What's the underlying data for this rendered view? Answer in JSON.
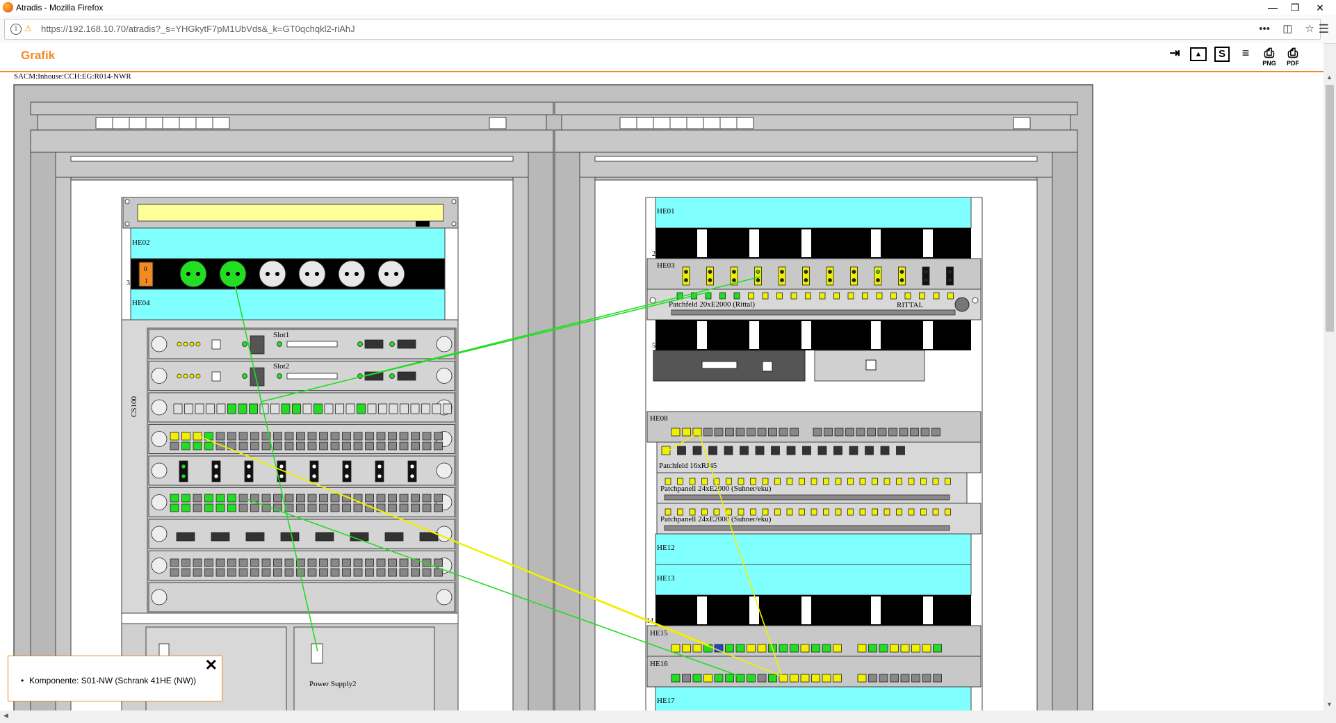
{
  "window": {
    "title": "Atradis - Mozilla Firefox",
    "minimize": "—",
    "restore": "❐",
    "close": "✕"
  },
  "browser": {
    "url": "https://192.168.10.70/atradis?_s=YHGkytF7pM1UbVds&_k=GT0qchqkl2-riAhJ",
    "more": "•••",
    "pocket": "◫",
    "bookmark": "☆",
    "menu": "☰"
  },
  "page": {
    "heading": "Grafik",
    "path": "SACM:Inhouse:CCH:EG:R014-NWR",
    "toolbar": [
      {
        "name": "export-icon",
        "glyph": "⇥",
        "label": ""
      },
      {
        "name": "image-icon",
        "glyph": "▲",
        "label": ""
      },
      {
        "name": "s-icon",
        "glyph": "S",
        "label": ""
      },
      {
        "name": "tree-icon",
        "glyph": "≡",
        "label": ""
      },
      {
        "name": "print-png-icon",
        "glyph": "⎙",
        "label": "PNG"
      },
      {
        "name": "print-pdf-icon",
        "glyph": "⎙",
        "label": "PDF"
      }
    ]
  },
  "rack_left": {
    "units": [
      "HE02",
      "HE04"
    ],
    "unit_numbers": [
      "3"
    ],
    "switch_on": "0",
    "switch_off": "1",
    "chassis_label": "CS100",
    "slots": [
      "Slot1",
      "Slot2"
    ],
    "power_supply": "Power Supply2"
  },
  "rack_right": {
    "units": [
      "HE01",
      "HE03",
      "HE08",
      "HE12",
      "HE13",
      "HE15",
      "HE16",
      "HE17"
    ],
    "unit_numbers": [
      "2",
      "5",
      "14"
    ],
    "patch_rittal": "Patchfeld 20xE2000 (Rittal)",
    "rittal_brand": "RITTAL",
    "patch_rj45": "Patchfeld 16xRJ45",
    "patch_suhner_1": "Patchpanell 24xE2000 (Suhner/eku)",
    "patch_suhner_2": "Patchpanell 24xE2000 (Suhner/eku)"
  },
  "colors": {
    "accent": "#f08a24",
    "unit_cyan": "#80ffff",
    "cable_green": "#22dd22",
    "cable_yellow": "#f0f000",
    "rack_gray": "#c0c0c0"
  },
  "popup": {
    "item": "Komponente: S01-NW (Schrank 41HE (NW))",
    "close": "✕"
  }
}
